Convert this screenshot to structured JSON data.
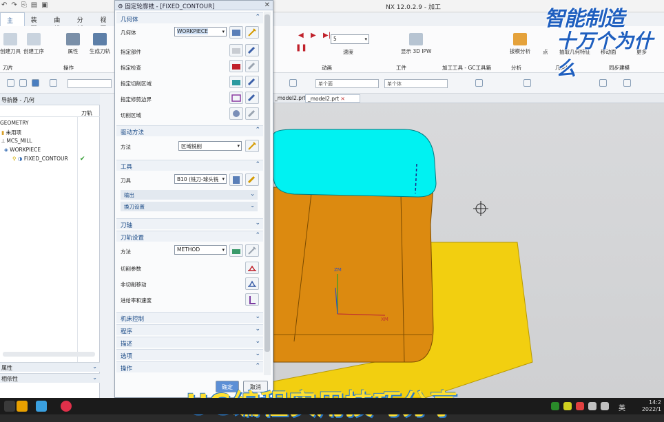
{
  "app": {
    "title": "NX 12.0.2.9 - 加工"
  },
  "ribbon": {
    "tabs": [
      "主页",
      "装配",
      "曲线",
      "分析",
      "视图"
    ],
    "active_tab": "主页",
    "buttons": [
      {
        "label": "创建刀具"
      },
      {
        "label": "创建工序"
      },
      {
        "label": "属性"
      },
      {
        "label": "生成刀轨"
      },
      {
        "label": "速度"
      },
      {
        "label": "显示 3D IPW"
      },
      {
        "label": "拔模分析"
      },
      {
        "label": "点"
      },
      {
        "label": "抽取几何特征"
      },
      {
        "label": "移动面"
      },
      {
        "label": "更多"
      }
    ],
    "speed_value": "5",
    "groups": [
      "刀片",
      "操作",
      "动画",
      "工件",
      "加工工具 - GC工具箱",
      "分析",
      "几何体",
      "同步建模"
    ]
  },
  "toolbar": {
    "filter1": "单个面",
    "filter2": "单个体"
  },
  "navigator": {
    "title": "导航器 - 几何",
    "col_toolpath": "刀轨",
    "items": [
      {
        "label": "GEOMETRY",
        "indent": 0
      },
      {
        "label": "未用项",
        "indent": 0
      },
      {
        "label": "MCS_MILL",
        "indent": 1
      },
      {
        "label": "WORKPIECE",
        "indent": 2
      },
      {
        "label": "FIXED_CONTOUR",
        "indent": 3,
        "check": "✔"
      }
    ],
    "bottom_panels": [
      "属性",
      "相依性"
    ]
  },
  "graphics": {
    "tabs": [
      "_model2.prt",
      "_model2.prt"
    ],
    "axis_labels": {
      "z": "ZM",
      "x": "XM"
    }
  },
  "dialog": {
    "title": "固定轮廓铣 - [FIXED_CONTOUR]",
    "sections": {
      "geometry": "几何体",
      "drive": "驱动方法",
      "tool": "工具",
      "axis": "刀轴",
      "toolpath": "刀轨设置",
      "machine": "机床控制",
      "program": "程序",
      "description": "描述",
      "options": "选项",
      "actions": "操作"
    },
    "geometry_rows": {
      "geometry_label": "几何体",
      "geometry_value": "WORKPIECE",
      "part": "指定部件",
      "check": "指定检查",
      "cut_area": "指定切削区域",
      "trim": "指定修剪边界",
      "cut_region": "切削区域"
    },
    "drive_rows": {
      "method_label": "方法",
      "method_value": "区域铣削"
    },
    "tool_rows": {
      "tool_label": "刀具",
      "tool_value": "B10 (铣刀-球头铣",
      "output": "输出",
      "tool_change": "换刀设置"
    },
    "toolpath_rows": {
      "method_label": "方法",
      "method_value": "METHOD",
      "cut_params": "切削参数",
      "non_cut": "非切削移动",
      "feeds": "进给率和速度"
    },
    "buttons": {
      "ok": "确定",
      "cancel": "取消"
    }
  },
  "watermark": {
    "line1": "智能制造",
    "line2": "十万个为什么",
    "caption": "UG编程实用技巧分享"
  },
  "taskbar": {
    "lang": "英",
    "time": "14:2",
    "date": "2022/1"
  },
  "colors": {
    "top_face": "#00f2f2",
    "body": "#e8a000",
    "floor": "#f4d100",
    "accent": "#1a4a86"
  }
}
